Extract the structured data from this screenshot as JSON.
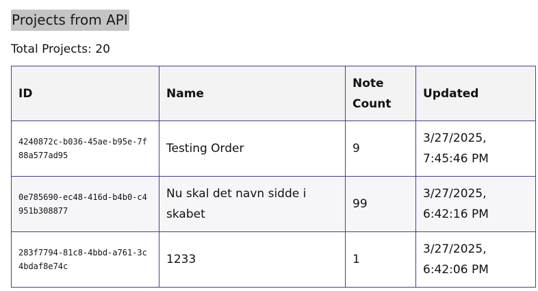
{
  "page": {
    "title": "Projects from API",
    "total_label": "Total Projects:",
    "total_count": "20"
  },
  "table": {
    "headers": {
      "id": "ID",
      "name": "Name",
      "note_count": "Note Count",
      "updated": "Updated"
    },
    "rows": [
      {
        "id": "4240872c-b036-45ae-b95e-7f88a577ad95",
        "name": "Testing Order",
        "note_count": "9",
        "updated": "3/27/2025, 7:45:46 PM"
      },
      {
        "id": "0e785690-ec48-416d-b4b0-c4951b308877",
        "name": "Nu skal det navn sidde i skabet",
        "note_count": "99",
        "updated": "3/27/2025, 6:42:16 PM"
      },
      {
        "id": "283f7794-81c8-4bbd-a761-3c4bdaf8e74c",
        "name": "1233",
        "note_count": "1",
        "updated": "3/27/2025, 6:42:06 PM"
      }
    ]
  }
}
